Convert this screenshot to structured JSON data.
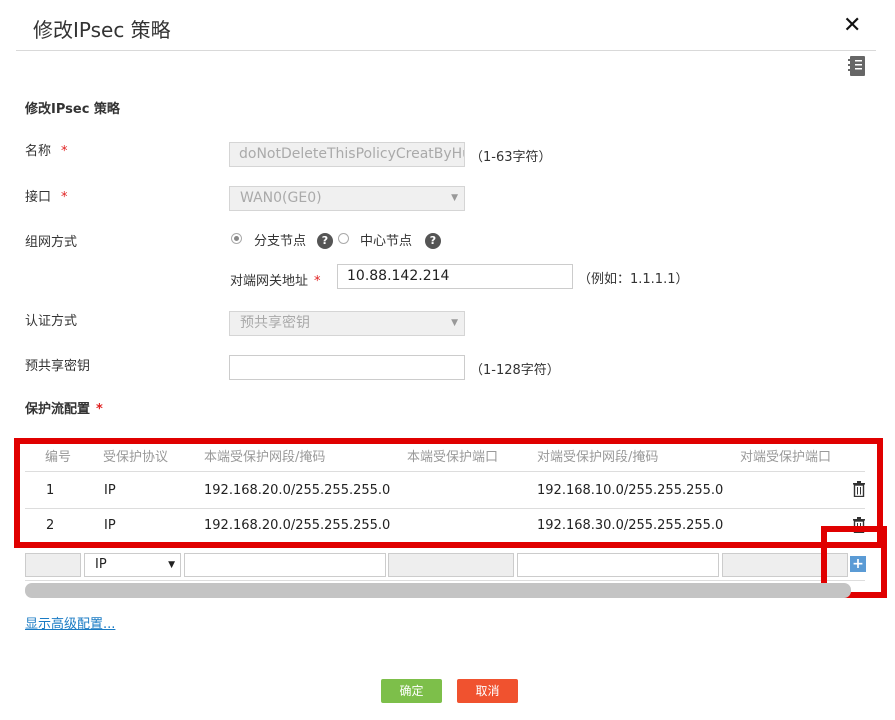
{
  "dialog": {
    "title": "修改IPsec 策略",
    "close_symbol": "✕",
    "section_title": "修改IPsec 策略"
  },
  "form": {
    "name": {
      "label": "名称",
      "value": "doNotDeleteThisPolicyCreatByHu",
      "hint": "（1-63字符）"
    },
    "interface": {
      "label": "接口",
      "value": "WAN0(GE0)"
    },
    "network_mode": {
      "label": "组网方式",
      "options": [
        {
          "label": "分支节点",
          "selected": true
        },
        {
          "label": "中心节点",
          "selected": false
        }
      ],
      "help_symbol": "?"
    },
    "peer_gateway": {
      "label": "对端网关地址",
      "value": "10.88.142.214",
      "hint": "（例如：1.1.1.1）"
    },
    "auth_method": {
      "label": "认证方式",
      "value": "预共享密钥"
    },
    "psk": {
      "label": "预共享密钥",
      "value": "",
      "hint": "（1-128字符）"
    },
    "protect_flow": {
      "label": "保护流配置"
    },
    "required_mark": "*"
  },
  "table": {
    "headers": [
      "编号",
      "受保护协议",
      "本端受保护网段/掩码",
      "本端受保护端口",
      "对端受保护网段/掩码",
      "对端受保护端口"
    ],
    "rows": [
      {
        "id": "1",
        "protocol": "IP",
        "local_net": "192.168.20.0/255.255.255.0",
        "local_port": "",
        "peer_net": "192.168.10.0/255.255.255.0",
        "peer_port": ""
      },
      {
        "id": "2",
        "protocol": "IP",
        "local_net": "192.168.20.0/255.255.255.0",
        "local_port": "",
        "peer_net": "192.168.30.0/255.255.255.0",
        "peer_port": ""
      }
    ],
    "new_row": {
      "protocol": "IP",
      "arrow": "▼"
    },
    "add_symbol": "+"
  },
  "advanced_link": "显示高级配置...",
  "buttons": {
    "ok": "确定",
    "cancel": "取消"
  },
  "colors": {
    "ok": "#7dbf4a",
    "cancel": "#f0522f",
    "highlight": "#e00000",
    "required": "#e02020",
    "link": "#1a7bc4"
  }
}
